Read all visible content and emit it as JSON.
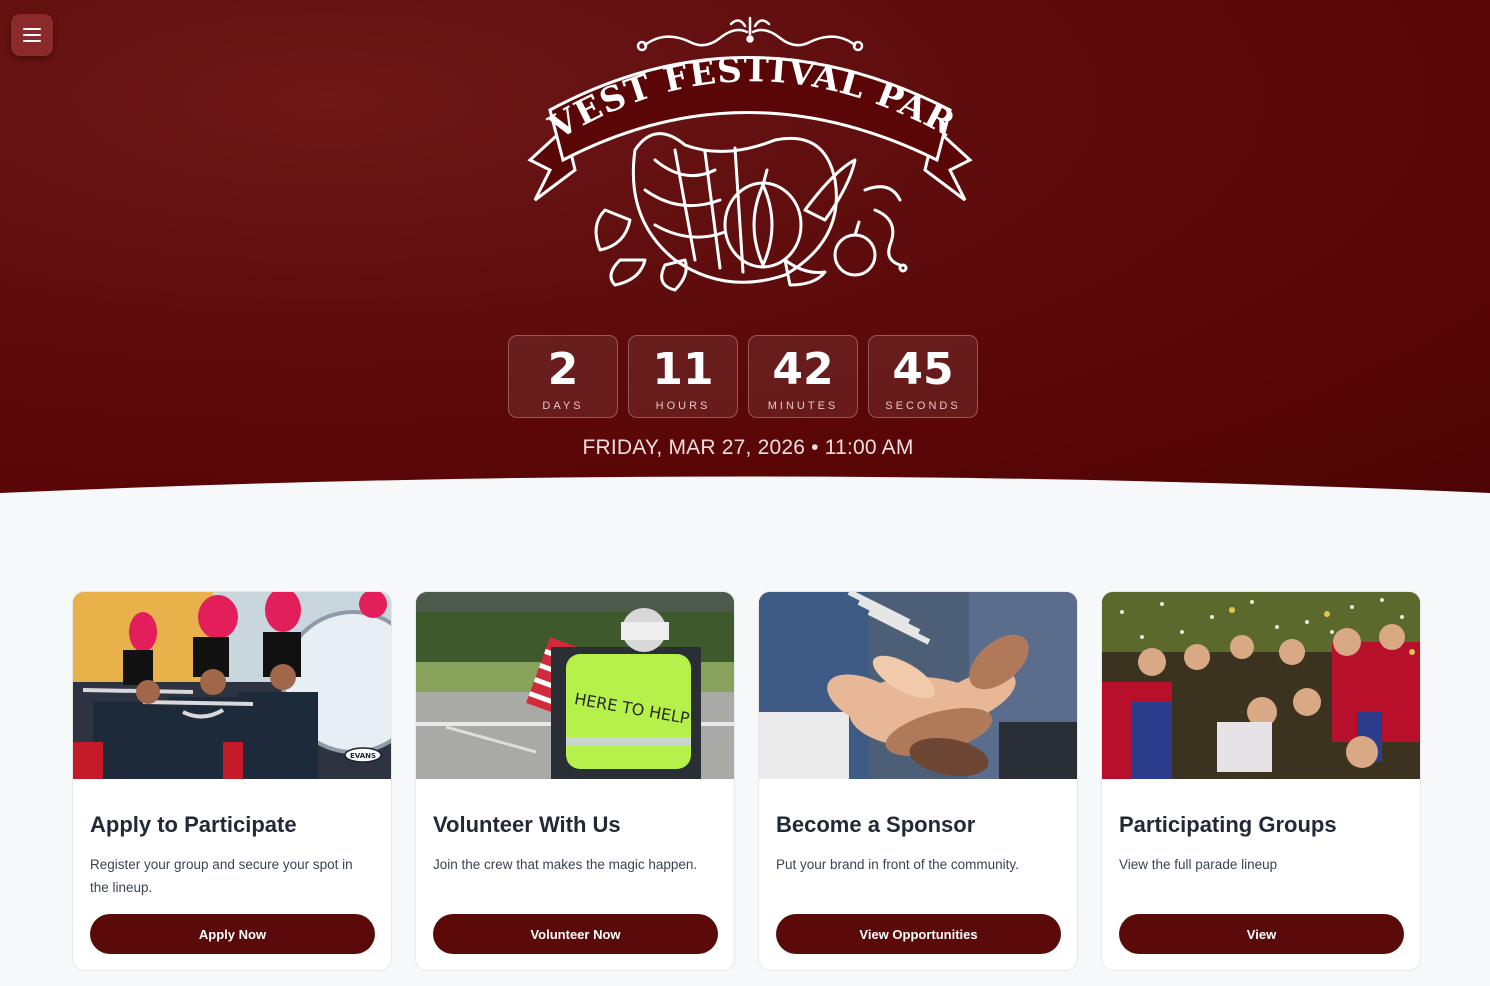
{
  "hero": {
    "logo": {
      "text": "HARVEST FESTIVAL PARADE"
    },
    "countdown": [
      {
        "value": "2",
        "unit": "DAYS"
      },
      {
        "value": "11",
        "unit": "HOURS"
      },
      {
        "value": "42",
        "unit": "MINUTES"
      },
      {
        "value": "45",
        "unit": "SECONDS"
      }
    ],
    "event_date": "FRIDAY, MAR 27, 2026 • 11:00 AM"
  },
  "cards": [
    {
      "title": "Apply to Participate",
      "description": "Register your group and secure your spot in the lineup.",
      "button": "Apply Now"
    },
    {
      "title": "Volunteer With Us",
      "description": "Join the crew that makes the magic happen.",
      "button": "Volunteer Now",
      "image_text": "HERE TO HELP"
    },
    {
      "title": "Become a Sponsor",
      "description": "Put your brand in front of the community.",
      "button": "View Opportunities"
    },
    {
      "title": "Participating Groups",
      "description": "View the full parade lineup",
      "button": "View"
    }
  ],
  "colors": {
    "hero_bg": "#5a0606",
    "button_bg": "#5b0a0a",
    "page_bg": "#f7f8fa"
  }
}
